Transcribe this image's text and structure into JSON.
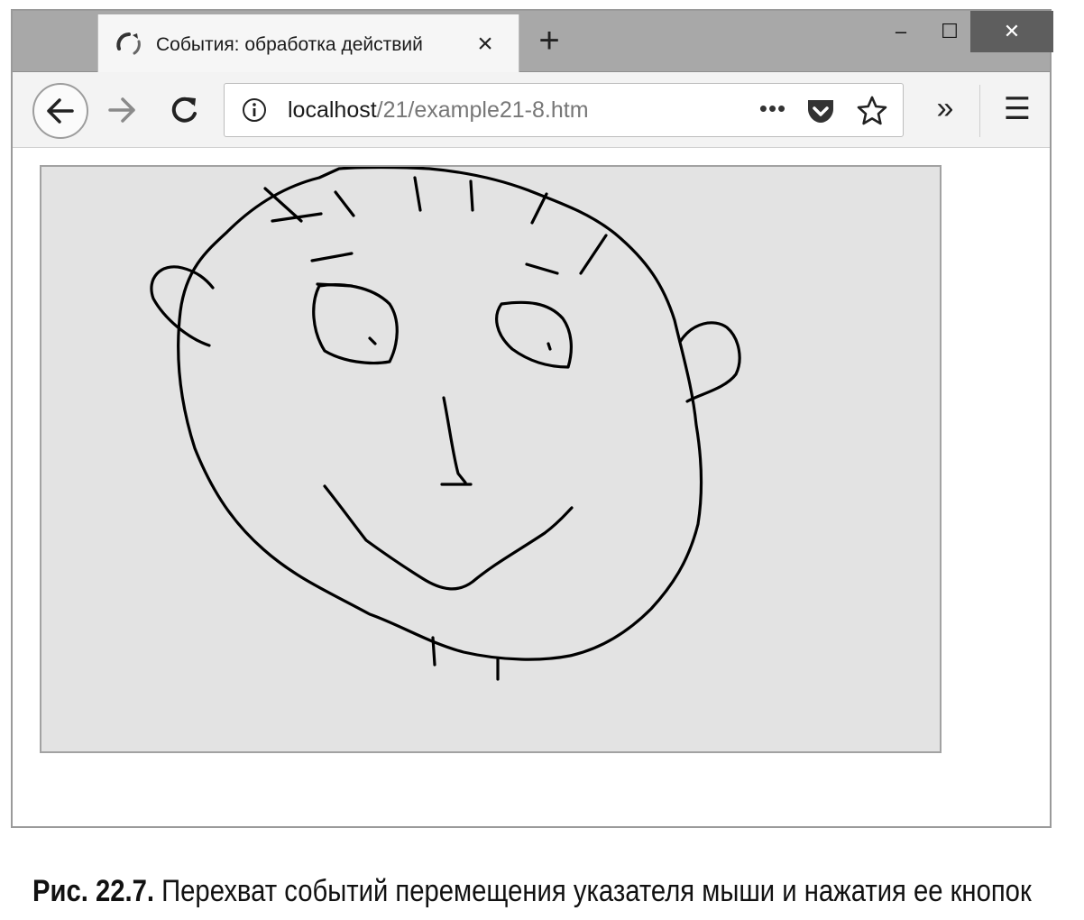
{
  "browser": {
    "tab": {
      "title": "События: обработка действий",
      "close_icon": "×"
    },
    "newtab_icon": "+",
    "window_controls": {
      "minimize": "–",
      "maximize": "☐",
      "close": "✕"
    },
    "toolbar": {
      "url_host": "localhost",
      "url_path": "/21/example21-8.htm",
      "more_icon": "•••",
      "overflow_icon": "»",
      "menu_icon": "☰"
    }
  },
  "caption": {
    "label": "Рис. 22.7.",
    "text": " Перехват событий перемещения указателя мыши и нажатия ее кнопок"
  },
  "colors": {
    "tabbar_bg": "#a8a8a8",
    "canvas_bg": "#e3e3e3",
    "stroke": "#000000",
    "close_button_bg": "#5e5e5e"
  }
}
